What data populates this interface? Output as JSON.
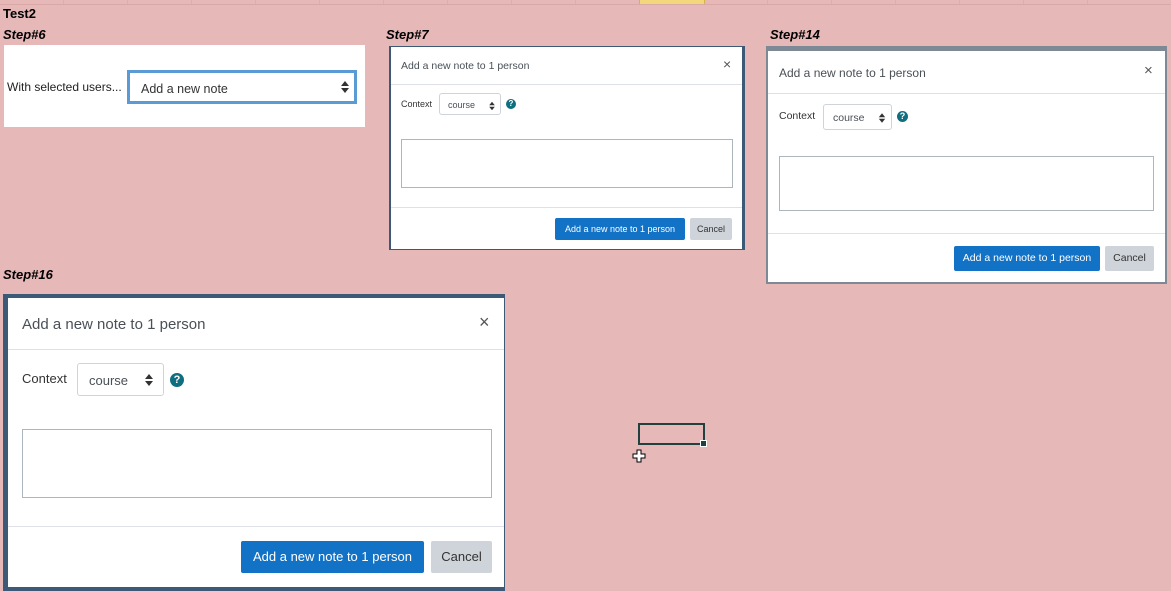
{
  "sheet": {
    "title": "Test2"
  },
  "steps": {
    "step6": "Step#6",
    "step7": "Step#7",
    "step14": "Step#14",
    "step16": "Step#16"
  },
  "step6_panel": {
    "label": "With selected users...",
    "select_value": "Add a new note"
  },
  "modal": {
    "title": "Add a new note to 1 person",
    "close": "×",
    "context_label": "Context",
    "context_value": "course",
    "help": "?",
    "primary_button": "Add a new note to 1 person",
    "cancel_button": "Cancel"
  },
  "icons": [
    "close-icon",
    "help-icon",
    "select-arrows-icon",
    "cell-cursor-icon"
  ],
  "colors": {
    "background": "#e6b8b7",
    "primary": "#1272c6",
    "help": "#0f6e80",
    "focus_border": "#5b9bd5"
  }
}
